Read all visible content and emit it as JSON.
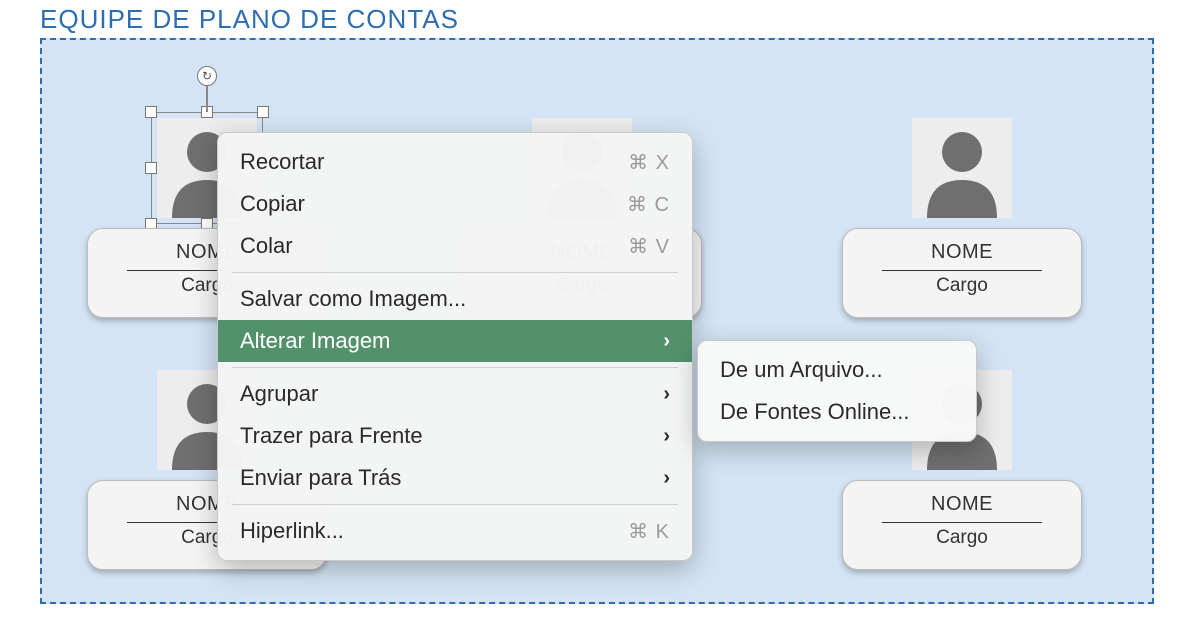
{
  "title": "EQUIPE DE PLANO DE CONTAS",
  "card": {
    "name": "NOME",
    "role": "Cargo"
  },
  "menu": {
    "cut": {
      "label": "Recortar",
      "shortcut": "⌘ X"
    },
    "copy": {
      "label": "Copiar",
      "shortcut": "⌘ C"
    },
    "paste": {
      "label": "Colar",
      "shortcut": "⌘ V"
    },
    "saveimg": {
      "label": "Salvar como Imagem..."
    },
    "change": {
      "label": "Alterar Imagem"
    },
    "group": {
      "label": "Agrupar"
    },
    "front": {
      "label": "Trazer para Frente"
    },
    "back": {
      "label": "Enviar para Trás"
    },
    "link": {
      "label": "Hiperlink...",
      "shortcut": "⌘ K"
    }
  },
  "submenu": {
    "fromFile": "De um Arquivo...",
    "fromOnline": "De Fontes Online..."
  }
}
